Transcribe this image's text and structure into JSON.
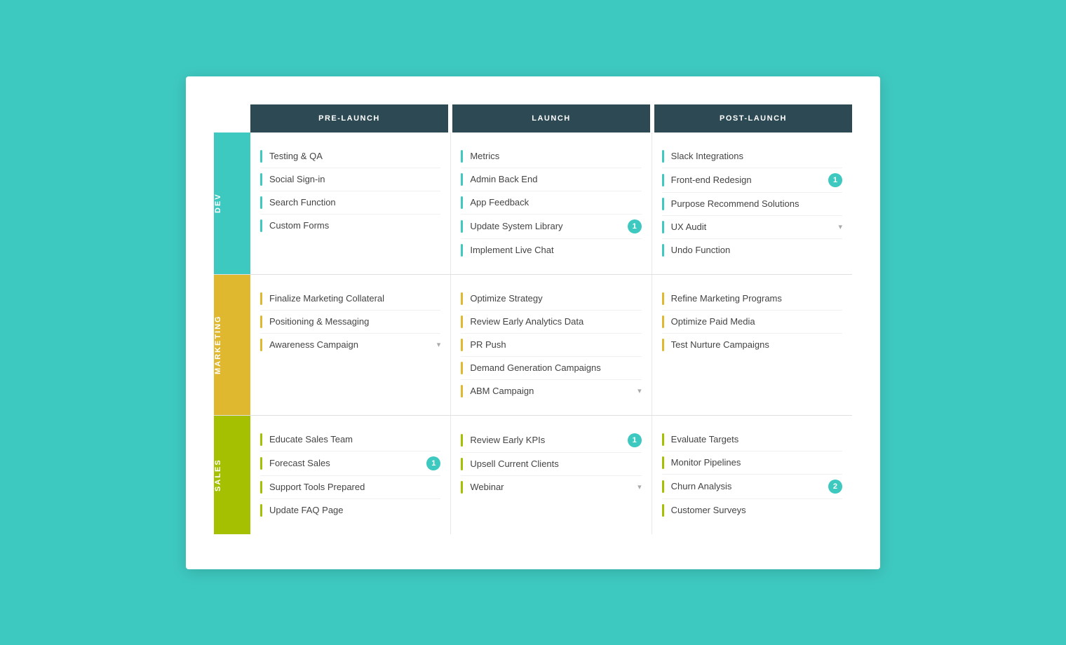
{
  "headers": {
    "col1": "PRE-LAUNCH",
    "col2": "LAUNCH",
    "col3": "POST-LAUNCH"
  },
  "rows": [
    {
      "label": "DEV",
      "color": "cyan",
      "col1": [
        {
          "text": "Testing & QA",
          "badge": null,
          "dropdown": false
        },
        {
          "text": "Social Sign-in",
          "badge": null,
          "dropdown": false
        },
        {
          "text": "Search Function",
          "badge": null,
          "dropdown": false
        },
        {
          "text": "Custom Forms",
          "badge": null,
          "dropdown": false
        }
      ],
      "col2": [
        {
          "text": "Metrics",
          "badge": null,
          "dropdown": false
        },
        {
          "text": "Admin Back End",
          "badge": null,
          "dropdown": false
        },
        {
          "text": "App Feedback",
          "badge": null,
          "dropdown": false
        },
        {
          "text": "Update System Library",
          "badge": "1",
          "dropdown": false
        },
        {
          "text": "Implement Live Chat",
          "badge": null,
          "dropdown": false
        }
      ],
      "col3": [
        {
          "text": "Slack Integrations",
          "badge": null,
          "dropdown": false
        },
        {
          "text": "Front-end Redesign",
          "badge": "1",
          "dropdown": false
        },
        {
          "text": "Purpose Recommend Solutions",
          "badge": null,
          "dropdown": false
        },
        {
          "text": "UX Audit",
          "badge": null,
          "dropdown": true
        },
        {
          "text": "Undo Function",
          "badge": null,
          "dropdown": false
        }
      ]
    },
    {
      "label": "MARKETING",
      "color": "yellow",
      "col1": [
        {
          "text": "Finalize Marketing Collateral",
          "badge": null,
          "dropdown": false
        },
        {
          "text": "Positioning & Messaging",
          "badge": null,
          "dropdown": false
        },
        {
          "text": "Awareness Campaign",
          "badge": null,
          "dropdown": true
        }
      ],
      "col2": [
        {
          "text": "Optimize Strategy",
          "badge": null,
          "dropdown": false
        },
        {
          "text": "Review Early Analytics Data",
          "badge": null,
          "dropdown": false
        },
        {
          "text": "PR Push",
          "badge": null,
          "dropdown": false
        },
        {
          "text": "Demand Generation Campaigns",
          "badge": null,
          "dropdown": false
        },
        {
          "text": "ABM Campaign",
          "badge": null,
          "dropdown": true
        }
      ],
      "col3": [
        {
          "text": "Refine Marketing Programs",
          "badge": null,
          "dropdown": false
        },
        {
          "text": "Optimize Paid Media",
          "badge": null,
          "dropdown": false
        },
        {
          "text": "Test Nurture Campaigns",
          "badge": null,
          "dropdown": false
        }
      ]
    },
    {
      "label": "SALES",
      "color": "green",
      "col1": [
        {
          "text": "Educate Sales Team",
          "badge": null,
          "dropdown": false
        },
        {
          "text": "Forecast Sales",
          "badge": "1",
          "dropdown": false
        },
        {
          "text": "Support Tools Prepared",
          "badge": null,
          "dropdown": false
        },
        {
          "text": "Update FAQ Page",
          "badge": null,
          "dropdown": false
        }
      ],
      "col2": [
        {
          "text": "Review Early KPIs",
          "badge": "1",
          "dropdown": false
        },
        {
          "text": "Upsell Current Clients",
          "badge": null,
          "dropdown": false
        },
        {
          "text": "Webinar",
          "badge": null,
          "dropdown": true
        }
      ],
      "col3": [
        {
          "text": "Evaluate Targets",
          "badge": null,
          "dropdown": false
        },
        {
          "text": "Monitor Pipelines",
          "badge": null,
          "dropdown": false
        },
        {
          "text": "Churn Analysis",
          "badge": "2",
          "dropdown": false
        },
        {
          "text": "Customer Surveys",
          "badge": null,
          "dropdown": false
        }
      ]
    }
  ]
}
